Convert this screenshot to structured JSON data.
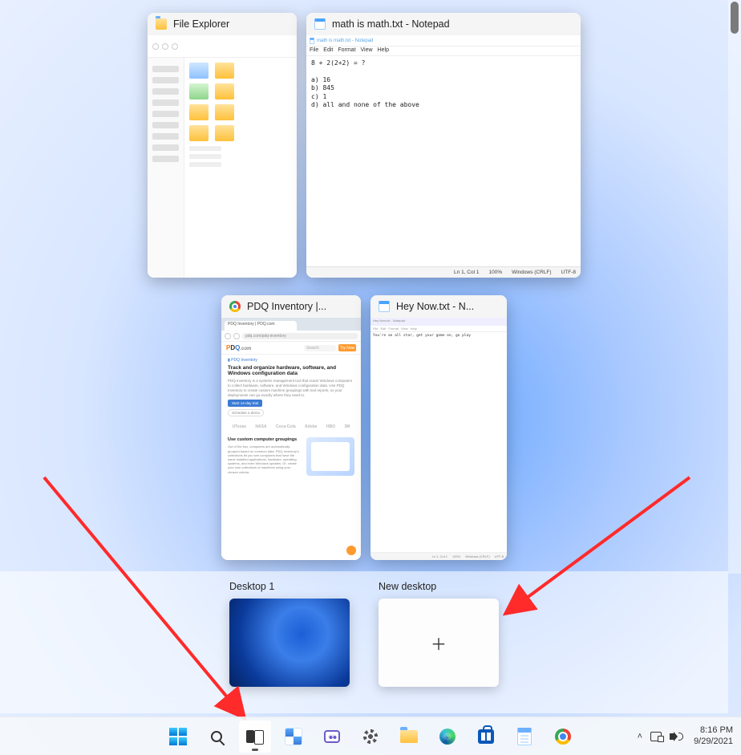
{
  "task_view": {
    "windows": [
      {
        "id": "file-explorer",
        "title": "File Explorer",
        "icon": "folder-icon"
      },
      {
        "id": "notepad-math",
        "title": "math is math.txt - Notepad",
        "icon": "notepad-icon",
        "content": {
          "titlebar": "math is math.txt - Notepad",
          "menu": [
            "File",
            "Edit",
            "Format",
            "View",
            "Help"
          ],
          "text": "8 + 2(2+2) = ?\n\na) 16\nb) 845\nc) 1\nd) all and none of the above",
          "status": {
            "pos": "Ln 1, Col 1",
            "zoom": "100%",
            "eol": "Windows (CRLF)",
            "enc": "UTF-8"
          }
        }
      },
      {
        "id": "chrome-pdq",
        "title": "PDQ Inventory |...",
        "icon": "chrome-icon",
        "content": {
          "tab_label": "PDQ Inventory | PDQ.com",
          "url_hint": "pdq.com/pdq-inventory",
          "brand": "PDQ.com",
          "search_placeholder": "Search",
          "nav_button": "Try Now",
          "badge": "PDQ Inventory",
          "heading": "Track and organize hardware, software, and Windows configuration data",
          "subtext": "PDQ Inventory is a systems management tool that scans Windows computers to collect hardware, software, and Windows configuration data. Use PDQ Inventory to create custom machine groupings with tool reports, so your deployments can go exactly where they need to.",
          "cta": "Start 14-day trial",
          "secondary": "Schedule a demo",
          "brands": [
            "UTexas",
            "NASA",
            "Coca-Cola",
            "Adobe",
            "HBO",
            "3M"
          ],
          "section2_heading": "Use custom computer groupings",
          "section2_text": "Out of the box, computers are automatically grouped based on common data. PDQ Inventory's collections let you see computers that have the same installed applications, hardware, operating systems, and even Windows updates. Or, create your own collections of machines using your chosen criteria."
        }
      },
      {
        "id": "notepad-heynow",
        "title": "Hey Now.txt - N...",
        "icon": "notepad-icon",
        "content": {
          "titlebar": "Hey Now.txt - Notepad",
          "menu": [
            "File",
            "Edit",
            "Format",
            "View",
            "Help"
          ],
          "text_line": "You're an all star, get your game on, go play",
          "status": {
            "pos": "Ln 1, Col 1",
            "zoom": "100%",
            "eol": "Windows (CRLF)",
            "enc": "UTF-8"
          }
        }
      }
    ]
  },
  "virtual_desktops": {
    "current_label": "Desktop 1",
    "new_label": "New desktop"
  },
  "taskbar": {
    "buttons": [
      {
        "name": "start",
        "label": "Start"
      },
      {
        "name": "search",
        "label": "Search"
      },
      {
        "name": "task-view",
        "label": "Task View",
        "active": true
      },
      {
        "name": "widgets",
        "label": "Widgets"
      },
      {
        "name": "chat",
        "label": "Chat"
      },
      {
        "name": "settings",
        "label": "Settings"
      },
      {
        "name": "file-explorer",
        "label": "File Explorer"
      },
      {
        "name": "edge",
        "label": "Microsoft Edge"
      },
      {
        "name": "store",
        "label": "Microsoft Store"
      },
      {
        "name": "notepad",
        "label": "Notepad"
      },
      {
        "name": "chrome",
        "label": "Google Chrome"
      }
    ],
    "tray": {
      "chevron": "˄"
    },
    "clock": {
      "time": "8:16 PM",
      "date": "9/29/2021"
    }
  },
  "annotations": {
    "arrow_to_taskview": "red-arrow",
    "arrow_to_new_desktop": "red-arrow"
  }
}
